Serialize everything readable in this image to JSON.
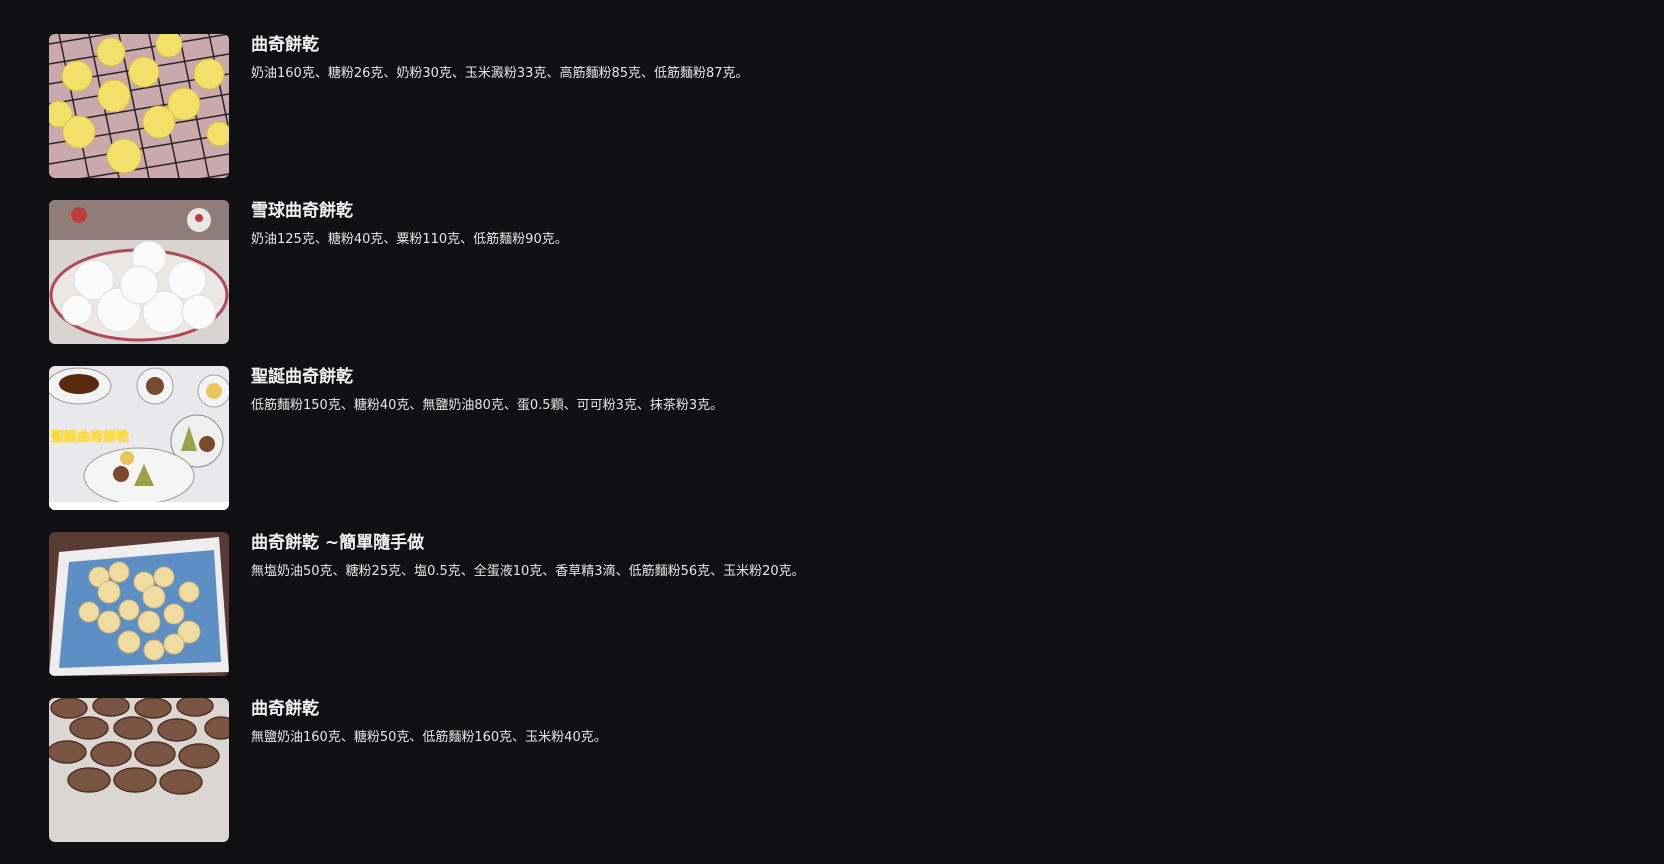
{
  "recipes": [
    {
      "title": "曲奇餅乾",
      "ingredients": "奶油160克、糖粉26克、奶粉30克、玉米澱粉33克、高筋麵粉85克、低筋麵粉87克。",
      "image": "yellow-swirl-cookies-on-rack"
    },
    {
      "title": "雪球曲奇餅乾",
      "ingredients": "奶油125克、糖粉40克、粟粉110克、低筋麵粉90克。",
      "image": "snowball-cookies-plate"
    },
    {
      "title": "聖誕曲奇餅乾",
      "ingredients": "低筋麵粉150克、糖粉40克、無鹽奶油80克、蛋0.5顆、可可粉3克、抹茶粉3克。",
      "image": "christmas-cookies-table",
      "image_caption": "聖誕曲奇餅乾"
    },
    {
      "title": "曲奇餅乾 ~簡單隨手做",
      "ingredients": "無塩奶油50克、糖粉25克、塩0.5克、全蛋液10克、香草精3滴、低筋麵粉56克、玉米粉20克。",
      "image": "flower-cookies-blue-plate"
    },
    {
      "title": "曲奇餅乾",
      "ingredients": "無鹽奶油160克、糖粉50克、低筋麵粉160克、玉米粉40克。",
      "image": "chocolate-swirl-cookies"
    }
  ]
}
